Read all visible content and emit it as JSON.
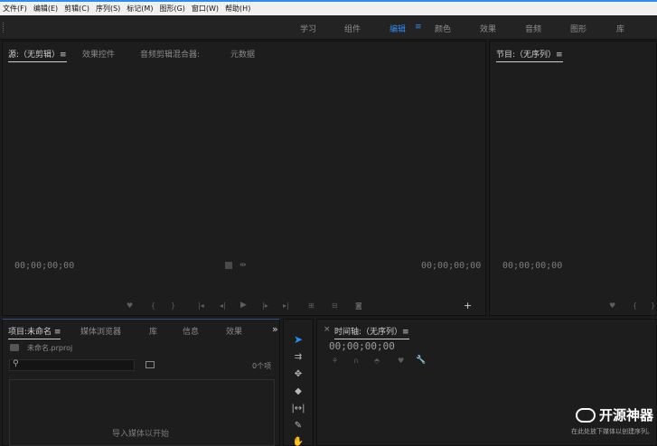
{
  "menu": [
    "文件(F)",
    "编辑(E)",
    "剪辑(C)",
    "序列(S)",
    "标记(M)",
    "图形(G)",
    "窗口(W)",
    "帮助(H)"
  ],
  "workspaces": {
    "learn": "学习",
    "assembly": "组件",
    "editing": "编辑",
    "menu_icon": "≡",
    "color": "颜色",
    "effects": "效果",
    "audio": "音频",
    "graphics": "图形",
    "libraries": "库"
  },
  "source_panel": {
    "tab_source": "源:（无剪辑）≡",
    "tab_effect_controls": "效果控件",
    "tab_audio_mixer": "音频剪辑混合器:",
    "tab_metadata": "元数据",
    "timecode_left": "00;00;00;00",
    "timecode_right": "00;00;00;00",
    "fit_icon": "filter-icon"
  },
  "program_panel": {
    "tab_program": "节目:（无序列）≡",
    "timecode": "00;00;00;00"
  },
  "project_panel": {
    "tab_project": "项目:未命名 ≡",
    "tab_media_browser": "媒体浏览器",
    "tab_libraries": "库",
    "tab_info": "信息",
    "tab_effects": "效果",
    "overflow": "»",
    "project_file": "未命名.prproj",
    "search_placeholder": "",
    "item_count": "0个项",
    "import_hint": "导入媒体以开始"
  },
  "timeline_panel": {
    "close": "×",
    "tab_timeline": "时间轴:（无序列）≡",
    "timecode": "00;00;00;00"
  },
  "watermark": {
    "title": "开源神器",
    "subtitle": "在此处放下媒体以创建序列。"
  },
  "colors": {
    "accent": "#2d8cf0",
    "panel_bg": "#1d1d1d",
    "app_bg": "#1b1b1b"
  }
}
